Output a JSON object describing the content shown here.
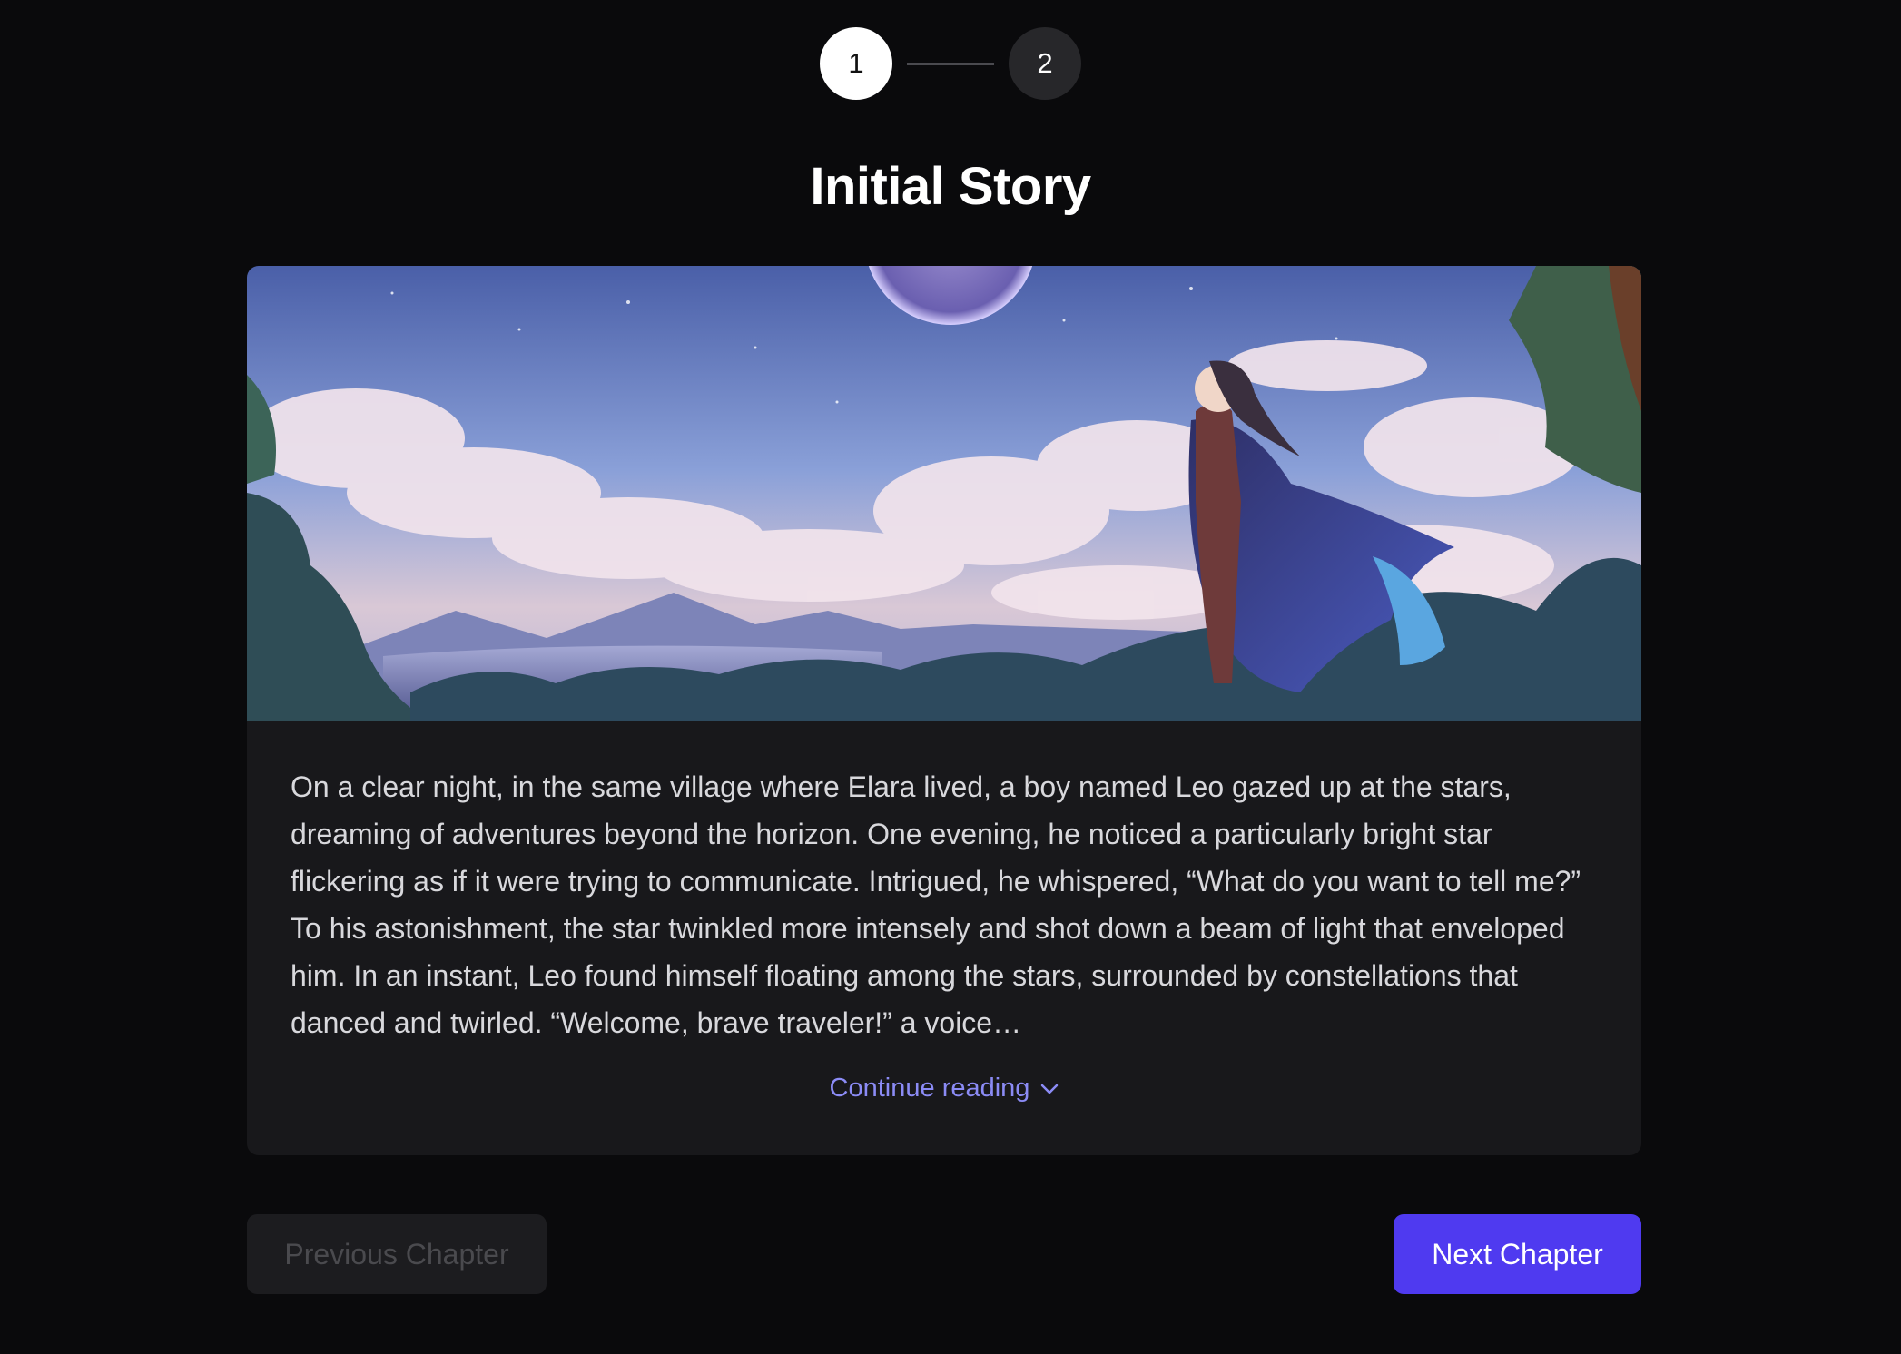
{
  "stepper": {
    "steps": [
      {
        "label": "1",
        "state": "active"
      },
      {
        "label": "2",
        "state": "inactive"
      }
    ]
  },
  "chapter": {
    "title": "Initial Story",
    "image_description": "anime-style illustration of a cloaked figure gazing at a starry sky with clouds and a moon over a forest landscape",
    "story_text": "On a clear night, in the same village where Elara lived, a boy named Leo gazed up at the stars, dreaming of adventures beyond the horizon. One evening, he noticed a particularly bright star flickering as if it were trying to communicate. Intrigued, he whispered, “What do you want to tell me?” To his astonishment, the star twinkled more intensely and shot down a beam of light that enveloped him. In an instant, Leo found himself floating among the stars, surrounded by constellations that danced and twirled. “Welcome, brave traveler!” a voice…",
    "continue_label": "Continue reading"
  },
  "navigation": {
    "prev_label": "Previous Chapter",
    "next_label": "Next Chapter",
    "prev_disabled": true
  },
  "colors": {
    "background": "#0a0a0c",
    "card": "#18181b",
    "accent": "#4f3af0",
    "link": "#8b8bf5"
  },
  "icons": {
    "continue": "chevron-down-icon"
  }
}
